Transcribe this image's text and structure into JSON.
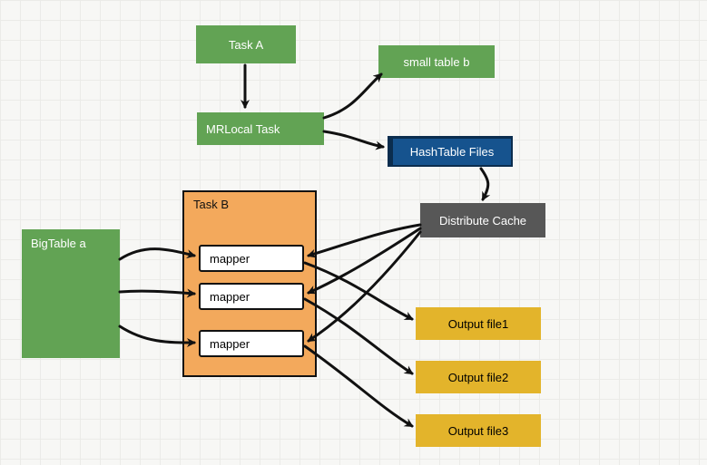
{
  "nodes": {
    "taskA": "Task A",
    "mrLocal": "MRLocal Task",
    "smallTableB": "small table b",
    "hashTable": "HashTable Files",
    "distributeCache": "Distribute Cache",
    "bigTableA": "BigTable a",
    "taskB": "Task B",
    "mapper1": "mapper",
    "mapper2": "mapper",
    "mapper3": "mapper",
    "output1": "Output file1",
    "output2": "Output file2",
    "output3": "Output file3"
  },
  "colors": {
    "green": "#62a354",
    "orange": "#f3a95c",
    "blue": "#16538e",
    "grey": "#575757",
    "gold": "#e3b42b"
  }
}
